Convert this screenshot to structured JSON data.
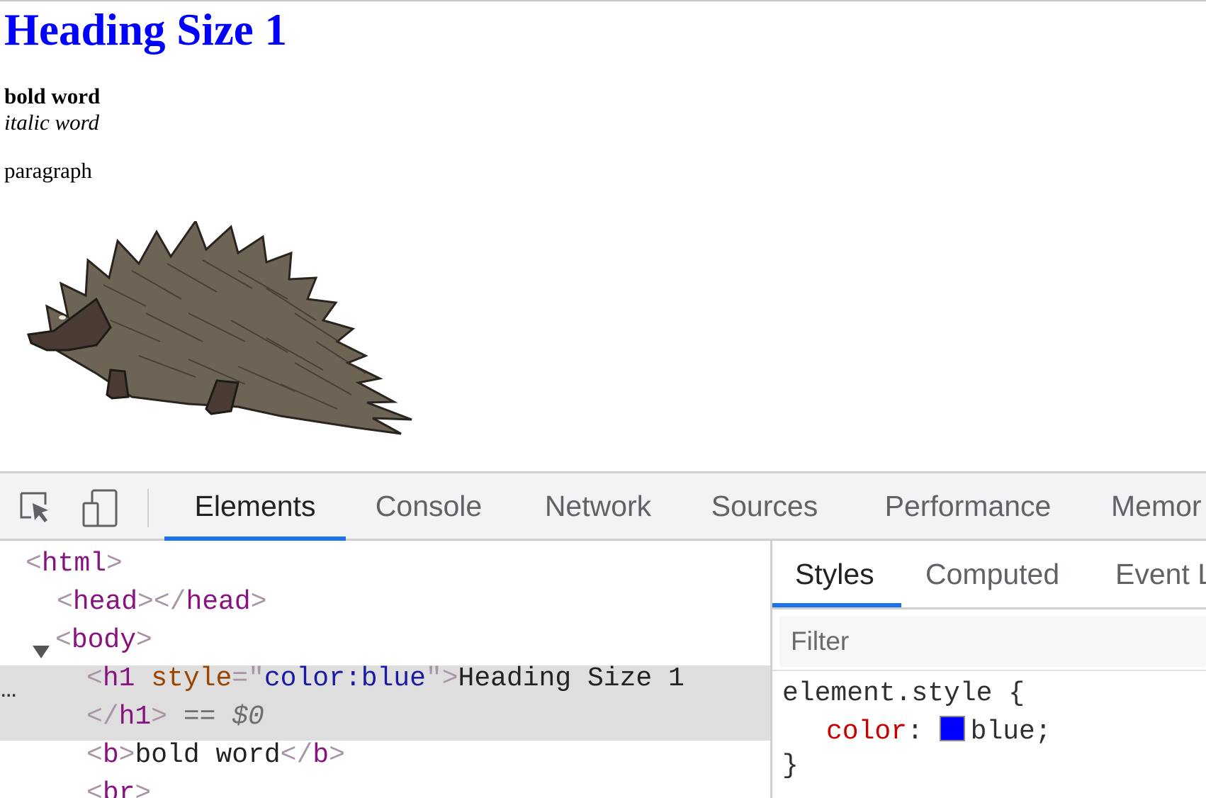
{
  "page": {
    "heading": "Heading Size 1",
    "heading_color": "#0000ff",
    "bold_text": "bold word",
    "italic_text": "italic word",
    "paragraph": "paragraph",
    "image": "porcupine-illustration"
  },
  "devtools": {
    "toolbar_icons": [
      "inspect-element-icon",
      "device-toolbar-icon"
    ],
    "tabs": [
      {
        "label": "Elements",
        "active": true
      },
      {
        "label": "Console",
        "active": false
      },
      {
        "label": "Network",
        "active": false
      },
      {
        "label": "Sources",
        "active": false
      },
      {
        "label": "Performance",
        "active": false
      },
      {
        "label": "Memor",
        "active": false
      }
    ],
    "accent_color": "#1a73e8",
    "dom": {
      "html_open": "html",
      "head": "head",
      "body": "body",
      "h1_tag": "h1",
      "h1_attr_name": "style",
      "h1_attr_value": "color:blue",
      "h1_text": "Heading Size 1",
      "h1_close": "h1",
      "selected_marker": "== $0",
      "dots": "...",
      "b_tag": "b",
      "b_text": "bold word",
      "br_tag": "br"
    },
    "styles_pane": {
      "tabs": [
        {
          "label": "Styles",
          "active": true
        },
        {
          "label": "Computed",
          "active": false
        },
        {
          "label": "Event L",
          "active": false
        }
      ],
      "filter_placeholder": "Filter",
      "selector": "element.style",
      "open_brace": "{",
      "property": "color",
      "value": "blue",
      "swatch_color": "#0000ff",
      "close_brace": "}"
    }
  }
}
